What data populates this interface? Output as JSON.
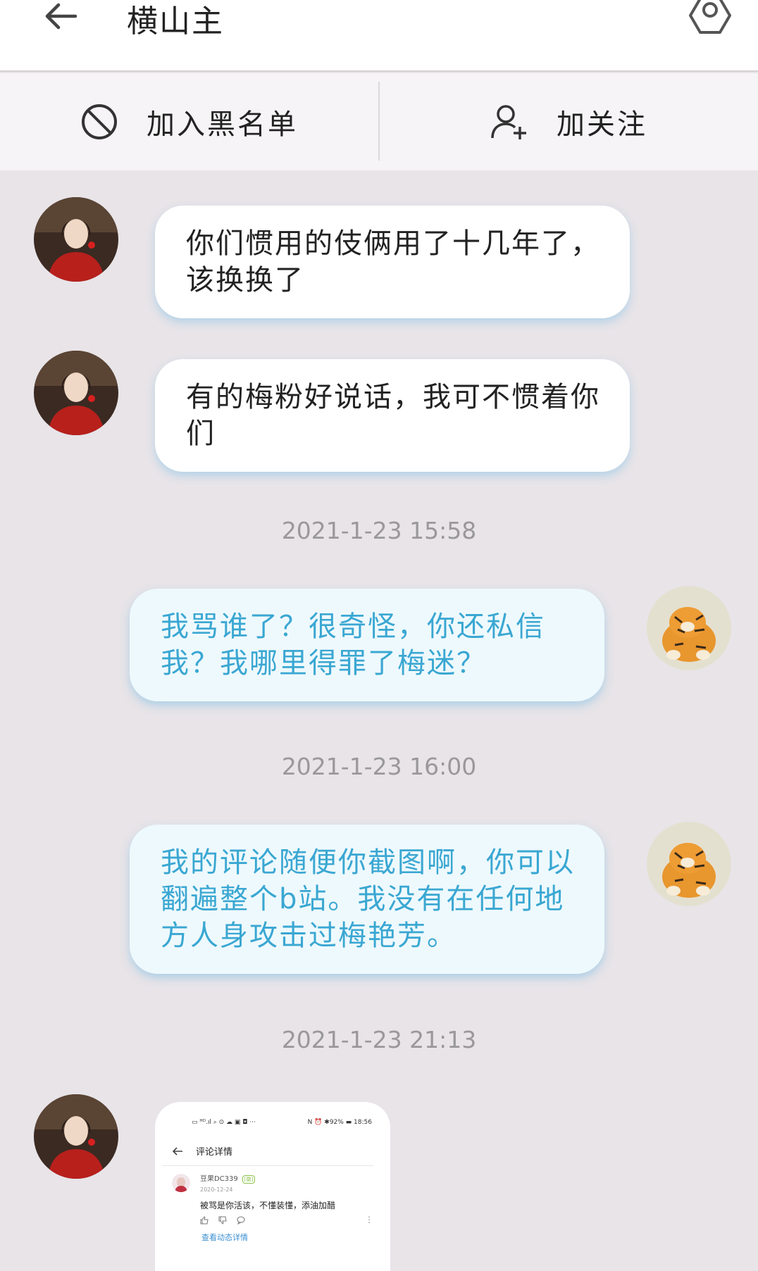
{
  "header": {
    "title": "横山主",
    "back_icon": "arrow-left-icon",
    "settings_icon": "settings-hexagon-icon"
  },
  "actions": {
    "blacklist": {
      "label": "加入黑名单",
      "icon": "block-icon"
    },
    "follow": {
      "label": "加关注",
      "icon": "add-user-icon"
    }
  },
  "messages": [
    {
      "side": "in",
      "text": "你们惯用的伎俩用了十几年了，该换换了"
    },
    {
      "side": "in",
      "text": "有的梅粉好说话，我可不惯着你们"
    },
    {
      "side": "out",
      "text": "我骂谁了？很奇怪，你还私信我？我哪里得罪了梅迷？"
    },
    {
      "side": "out",
      "text": "我的评论随便你截图啊，你可以翻遍整个b站。我没有在任何地方人身攻击过梅艳芳。"
    }
  ],
  "timestamps": [
    "2021-1-23 15:58",
    "2021-1-23 16:00",
    "2021-1-23 21:13"
  ],
  "shared_screenshot": {
    "status_left": "▭ ᴴᴰ.ıl ⌕ ⊙ ☁ ▣ ◘ ···",
    "status_right": "N ⏰ ✱92% ▬ 18:56",
    "page_title": "评论详情",
    "username": "豆果DC339",
    "badge": "[徽]",
    "date": "2020-12-24",
    "comment": "被骂是你活该，不懂装懂，添油加醋",
    "link": "查看动态详情"
  },
  "colors": {
    "background": "#e8e4e8",
    "incoming_bubble": "#ffffff",
    "outgoing_bubble": "#eef9fd",
    "outgoing_text": "#3aa7d2",
    "timestamp": "#9a989a"
  }
}
